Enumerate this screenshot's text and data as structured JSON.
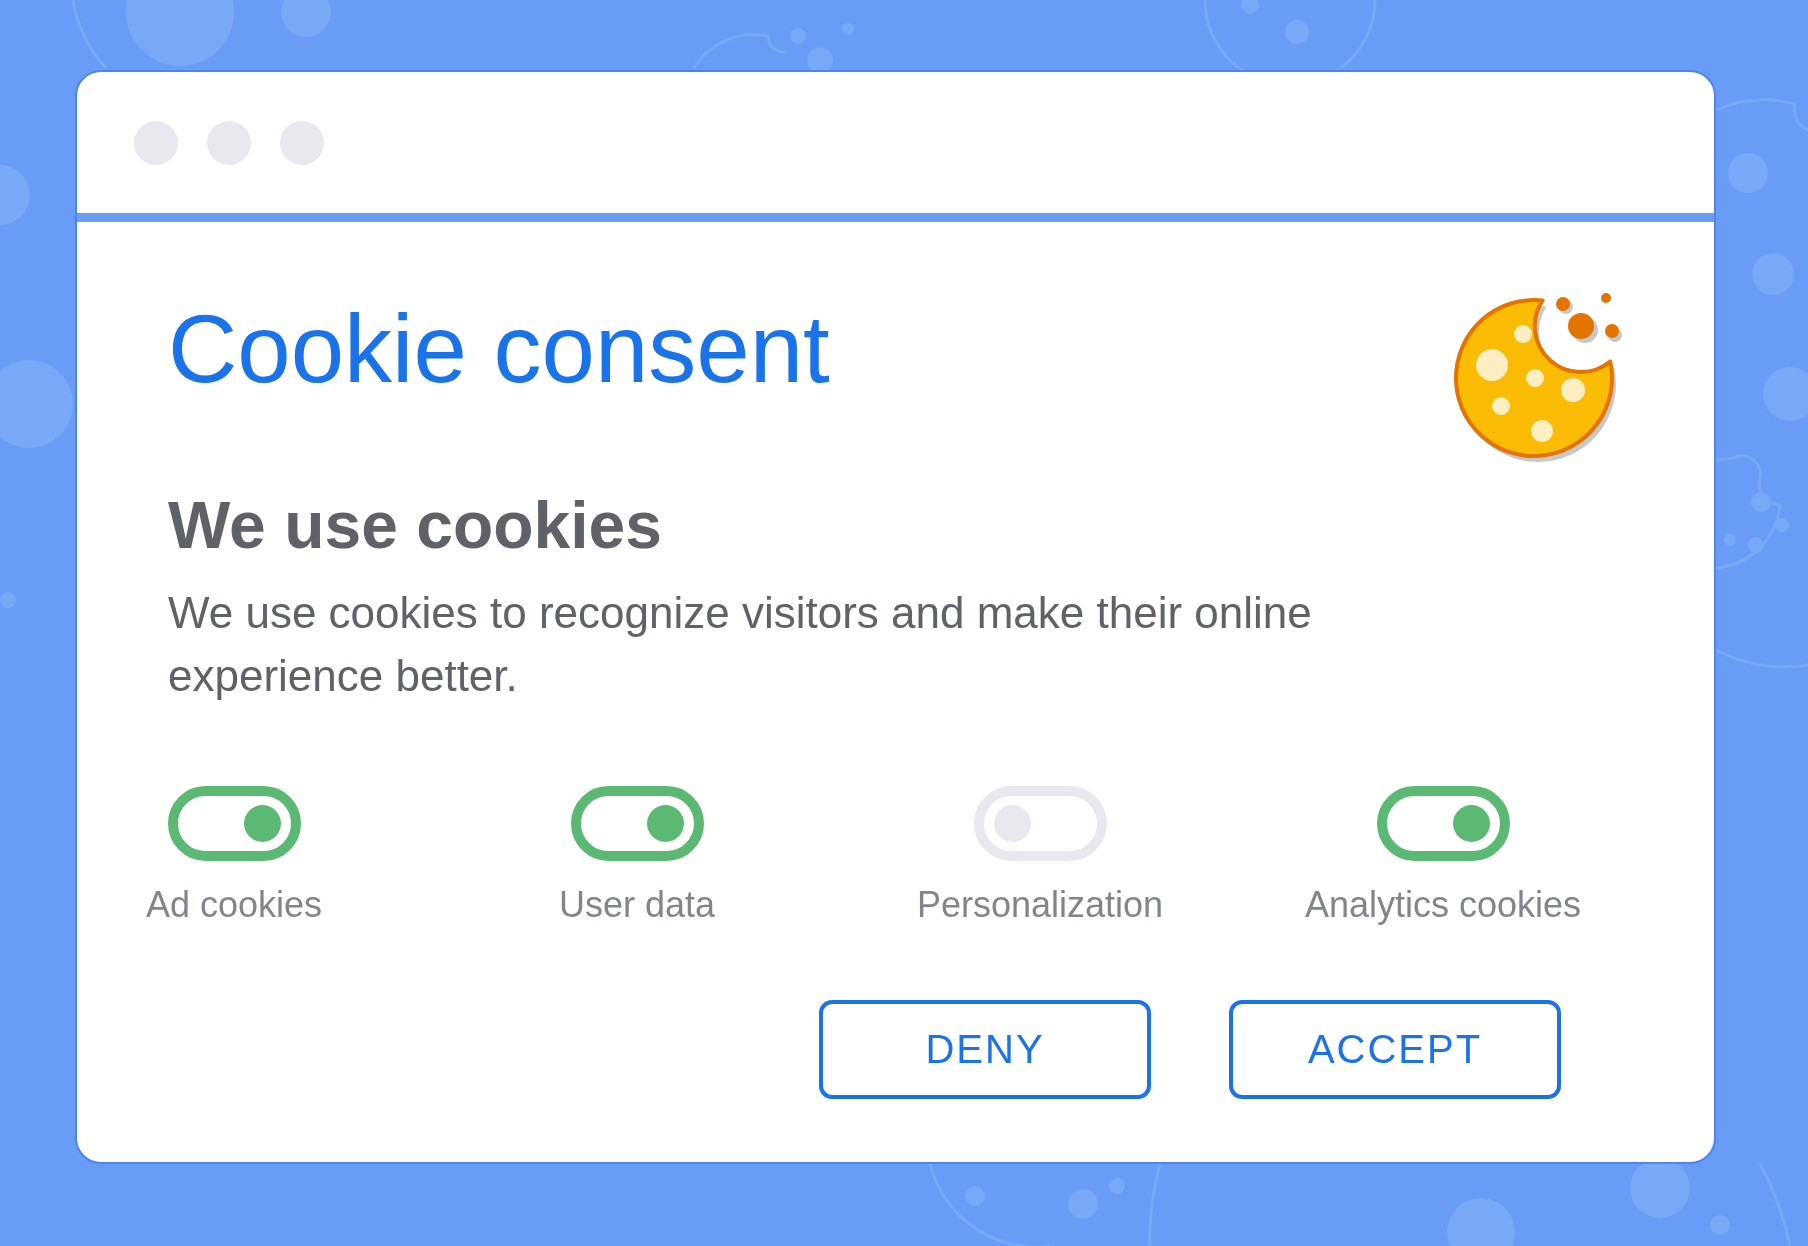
{
  "dialog": {
    "title": "Cookie consent",
    "heading": "We use cookies",
    "message": "We use cookies to recognize visitors and make their online experience better."
  },
  "toggles": [
    {
      "label": "Ad cookies",
      "on": true
    },
    {
      "label": "User data",
      "on": true
    },
    {
      "label": "Personalization",
      "on": false
    },
    {
      "label": "Analytics cookies",
      "on": true
    }
  ],
  "buttons": [
    "DENY",
    "ACCEPT"
  ]
}
